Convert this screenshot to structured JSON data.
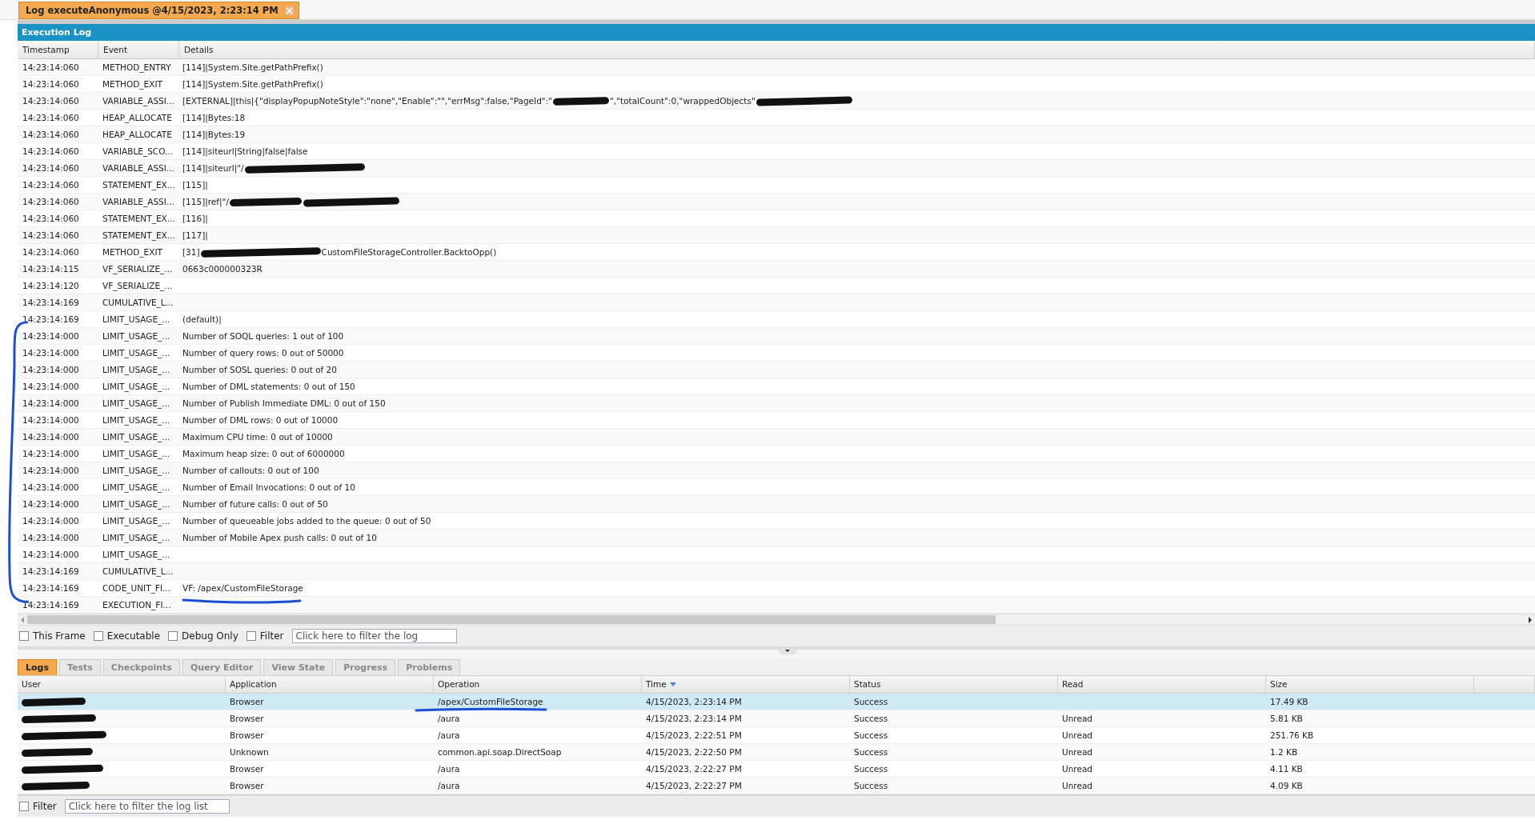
{
  "editor_tab": {
    "title": "Log executeAnonymous @4/15/2023, 2:23:14 PM",
    "closable": true
  },
  "execution_log": {
    "title": "Execution Log",
    "columns": [
      "Timestamp",
      "Event",
      "Details"
    ],
    "rows": [
      {
        "timestamp": "14:23:14:060",
        "event": "METHOD_ENTRY",
        "details": [
          {
            "kind": "text",
            "text": "[114]|System.Site.getPathPrefix()"
          }
        ]
      },
      {
        "timestamp": "14:23:14:060",
        "event": "METHOD_EXIT",
        "details": [
          {
            "kind": "text",
            "text": "[114]|System.Site.getPathPrefix()"
          }
        ]
      },
      {
        "timestamp": "14:23:14:060",
        "event": "VARIABLE_ASSI...",
        "details": [
          {
            "kind": "text",
            "text": "[EXTERNAL]|this|{\"displayPopupNoteStyle\":\"none\",\"Enable\":\"\",\"errMsg\":false,\"PageId\":\""
          },
          {
            "kind": "redacted"
          },
          {
            "kind": "text",
            "text": "\",\"totalCount\":0,\"wrappedObjects\""
          },
          {
            "kind": "redacted"
          }
        ]
      },
      {
        "timestamp": "14:23:14:060",
        "event": "HEAP_ALLOCATE",
        "details": [
          {
            "kind": "text",
            "text": "[114]|Bytes:18"
          }
        ]
      },
      {
        "timestamp": "14:23:14:060",
        "event": "HEAP_ALLOCATE",
        "details": [
          {
            "kind": "text",
            "text": "[114]|Bytes:19"
          }
        ]
      },
      {
        "timestamp": "14:23:14:060",
        "event": "VARIABLE_SCO...",
        "details": [
          {
            "kind": "text",
            "text": "[114]|siteurl|String|false|false"
          }
        ]
      },
      {
        "timestamp": "14:23:14:060",
        "event": "VARIABLE_ASSI...",
        "details": [
          {
            "kind": "text",
            "text": "[114]|siteurl|\"/"
          },
          {
            "kind": "redacted"
          }
        ]
      },
      {
        "timestamp": "14:23:14:060",
        "event": "STATEMENT_EX...",
        "details": [
          {
            "kind": "text",
            "text": "[115]|"
          }
        ]
      },
      {
        "timestamp": "14:23:14:060",
        "event": "VARIABLE_ASSI...",
        "details": [
          {
            "kind": "text",
            "text": "[115]|ref|\"/"
          },
          {
            "kind": "redacted"
          },
          {
            "kind": "redacted"
          }
        ]
      },
      {
        "timestamp": "14:23:14:060",
        "event": "STATEMENT_EX...",
        "details": [
          {
            "kind": "text",
            "text": "[116]|"
          }
        ]
      },
      {
        "timestamp": "14:23:14:060",
        "event": "STATEMENT_EX...",
        "details": [
          {
            "kind": "text",
            "text": "[117]|"
          }
        ]
      },
      {
        "timestamp": "14:23:14:060",
        "event": "METHOD_EXIT",
        "details": [
          {
            "kind": "text",
            "text": "[31]"
          },
          {
            "kind": "redacted"
          },
          {
            "kind": "text",
            "text": "CustomFileStorageController.BacktoOpp()"
          }
        ]
      },
      {
        "timestamp": "14:23:14:115",
        "event": "VF_SERIALIZE_...",
        "details": [
          {
            "kind": "text",
            "text": "0663c000000323R"
          }
        ]
      },
      {
        "timestamp": "14:23:14:120",
        "event": "VF_SERIALIZE_...",
        "details": []
      },
      {
        "timestamp": "14:23:14:169",
        "event": "CUMULATIVE_L...",
        "details": []
      },
      {
        "timestamp": "14:23:14:169",
        "event": "LIMIT_USAGE_...",
        "details": [
          {
            "kind": "text",
            "text": "(default)|"
          }
        ]
      },
      {
        "timestamp": "14:23:14:000",
        "event": "LIMIT_USAGE_...",
        "details": [
          {
            "kind": "text",
            "text": "Number of SOQL queries: 1 out of 100"
          }
        ]
      },
      {
        "timestamp": "14:23:14:000",
        "event": "LIMIT_USAGE_...",
        "details": [
          {
            "kind": "text",
            "text": "Number of query rows: 0 out of 50000"
          }
        ]
      },
      {
        "timestamp": "14:23:14:000",
        "event": "LIMIT_USAGE_...",
        "details": [
          {
            "kind": "text",
            "text": "Number of SOSL queries: 0 out of 20"
          }
        ]
      },
      {
        "timestamp": "14:23:14:000",
        "event": "LIMIT_USAGE_...",
        "details": [
          {
            "kind": "text",
            "text": "Number of DML statements: 0 out of 150"
          }
        ]
      },
      {
        "timestamp": "14:23:14:000",
        "event": "LIMIT_USAGE_...",
        "details": [
          {
            "kind": "text",
            "text": "Number of Publish Immediate DML: 0 out of 150"
          }
        ]
      },
      {
        "timestamp": "14:23:14:000",
        "event": "LIMIT_USAGE_...",
        "details": [
          {
            "kind": "text",
            "text": "Number of DML rows: 0 out of 10000"
          }
        ]
      },
      {
        "timestamp": "14:23:14:000",
        "event": "LIMIT_USAGE_...",
        "details": [
          {
            "kind": "text",
            "text": "Maximum CPU time: 0 out of 10000"
          }
        ]
      },
      {
        "timestamp": "14:23:14:000",
        "event": "LIMIT_USAGE_...",
        "details": [
          {
            "kind": "text",
            "text": "Maximum heap size: 0 out of 6000000"
          }
        ]
      },
      {
        "timestamp": "14:23:14:000",
        "event": "LIMIT_USAGE_...",
        "details": [
          {
            "kind": "text",
            "text": "Number of callouts: 0 out of 100"
          }
        ]
      },
      {
        "timestamp": "14:23:14:000",
        "event": "LIMIT_USAGE_...",
        "details": [
          {
            "kind": "text",
            "text": "Number of Email Invocations: 0 out of 10"
          }
        ]
      },
      {
        "timestamp": "14:23:14:000",
        "event": "LIMIT_USAGE_...",
        "details": [
          {
            "kind": "text",
            "text": "Number of future calls: 0 out of 50"
          }
        ]
      },
      {
        "timestamp": "14:23:14:000",
        "event": "LIMIT_USAGE_...",
        "details": [
          {
            "kind": "text",
            "text": "Number of queueable jobs added to the queue: 0 out of 50"
          }
        ]
      },
      {
        "timestamp": "14:23:14:000",
        "event": "LIMIT_USAGE_...",
        "details": [
          {
            "kind": "text",
            "text": "Number of Mobile Apex push calls: 0 out of 10"
          }
        ]
      },
      {
        "timestamp": "14:23:14:000",
        "event": "LIMIT_USAGE_...",
        "details": []
      },
      {
        "timestamp": "14:23:14:169",
        "event": "CUMULATIVE_L...",
        "details": []
      },
      {
        "timestamp": "14:23:14:169",
        "event": "CODE_UNIT_FI...",
        "details": [
          {
            "kind": "text",
            "text": "VF: /apex/CustomFileStorage"
          }
        ]
      },
      {
        "timestamp": "14:23:14:169",
        "event": "EXECUTION_FI...",
        "details": []
      }
    ]
  },
  "log_filters": {
    "options": [
      {
        "label": "This Frame",
        "checked": false
      },
      {
        "label": "Executable",
        "checked": false
      },
      {
        "label": "Debug Only",
        "checked": false
      },
      {
        "label": "Filter",
        "checked": false
      }
    ],
    "placeholder": "Click here to filter the log"
  },
  "panel_tabs": [
    {
      "label": "Logs",
      "selected": true
    },
    {
      "label": "Tests",
      "selected": false
    },
    {
      "label": "Checkpoints",
      "selected": false
    },
    {
      "label": "Query Editor",
      "selected": false
    },
    {
      "label": "View State",
      "selected": false
    },
    {
      "label": "Progress",
      "selected": false
    },
    {
      "label": "Problems",
      "selected": false
    }
  ],
  "logs_table": {
    "columns": [
      {
        "label": "User",
        "sorted": false
      },
      {
        "label": "Application",
        "sorted": false
      },
      {
        "label": "Operation",
        "sorted": false
      },
      {
        "label": "Time",
        "sorted": true
      },
      {
        "label": "Status",
        "sorted": false
      },
      {
        "label": "Read",
        "sorted": false
      },
      {
        "label": "Size",
        "sorted": false
      }
    ],
    "rows": [
      {
        "selected": true,
        "application": "Browser",
        "operation": "/apex/CustomFileStorage",
        "time": "4/15/2023, 2:23:14 PM",
        "status": "Success",
        "size": "17.49 KB"
      },
      {
        "selected": false,
        "application": "Browser",
        "operation": "/aura",
        "time": "4/15/2023, 2:23:14 PM",
        "status": "Success",
        "read": "Unread",
        "size": "5.81 KB"
      },
      {
        "selected": false,
        "application": "Browser",
        "operation": "/aura",
        "time": "4/15/2023, 2:22:51 PM",
        "status": "Success",
        "read": "Unread",
        "size": "251.76 KB"
      },
      {
        "selected": false,
        "application": "Unknown",
        "operation": "common.api.soap.DirectSoap",
        "time": "4/15/2023, 2:22:50 PM",
        "status": "Success",
        "read": "Unread",
        "size": "1.2 KB"
      },
      {
        "selected": false,
        "application": "Browser",
        "operation": "/aura",
        "time": "4/15/2023, 2:22:27 PM",
        "status": "Success",
        "read": "Unread",
        "size": "4.11 KB"
      },
      {
        "selected": false,
        "application": "Browser",
        "operation": "/aura",
        "time": "4/15/2023, 2:22:27 PM",
        "status": "Success",
        "read": "Unread",
        "size": "4.09 KB"
      }
    ]
  },
  "list_filter": {
    "label": "Filter",
    "checked": false,
    "placeholder": "Click here to filter the log list"
  }
}
